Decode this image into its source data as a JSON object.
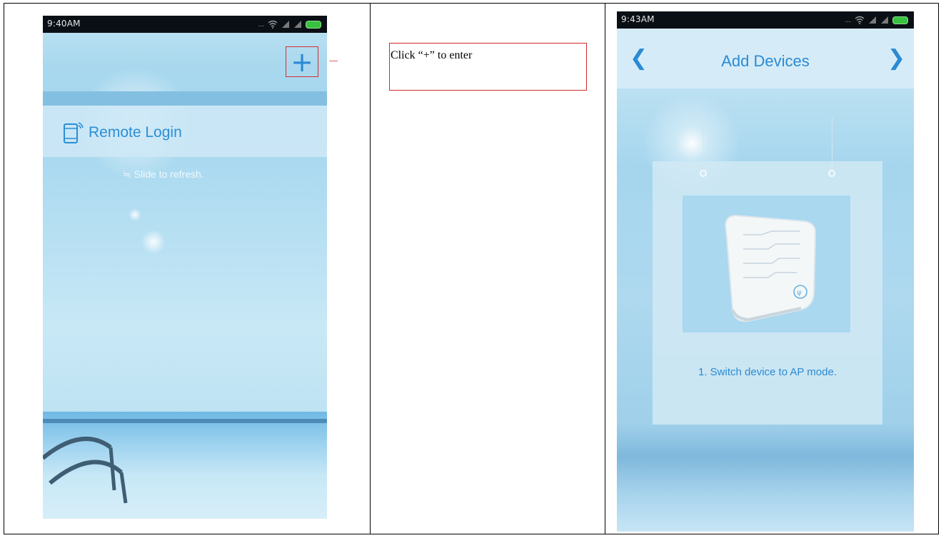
{
  "left_screen": {
    "status_time": "9:40AM",
    "status_dots": "...",
    "remote_login": "Remote Login",
    "slide_hint": "Slide to refresh.",
    "add_button": "+"
  },
  "annotation": {
    "text": "Click “+” to enter",
    "highlight_color": "#d02a2a"
  },
  "right_screen": {
    "status_time": "9:43AM",
    "status_dots": "...",
    "title": "Add Devices",
    "back_icon": "chevron-left-icon",
    "next_icon": "chevron-right-icon",
    "step_caption": "1. Switch device to AP mode."
  },
  "colors": {
    "accent": "#2b8ad3",
    "status_bar": "#0a0f16",
    "battery": "#39c23f"
  }
}
